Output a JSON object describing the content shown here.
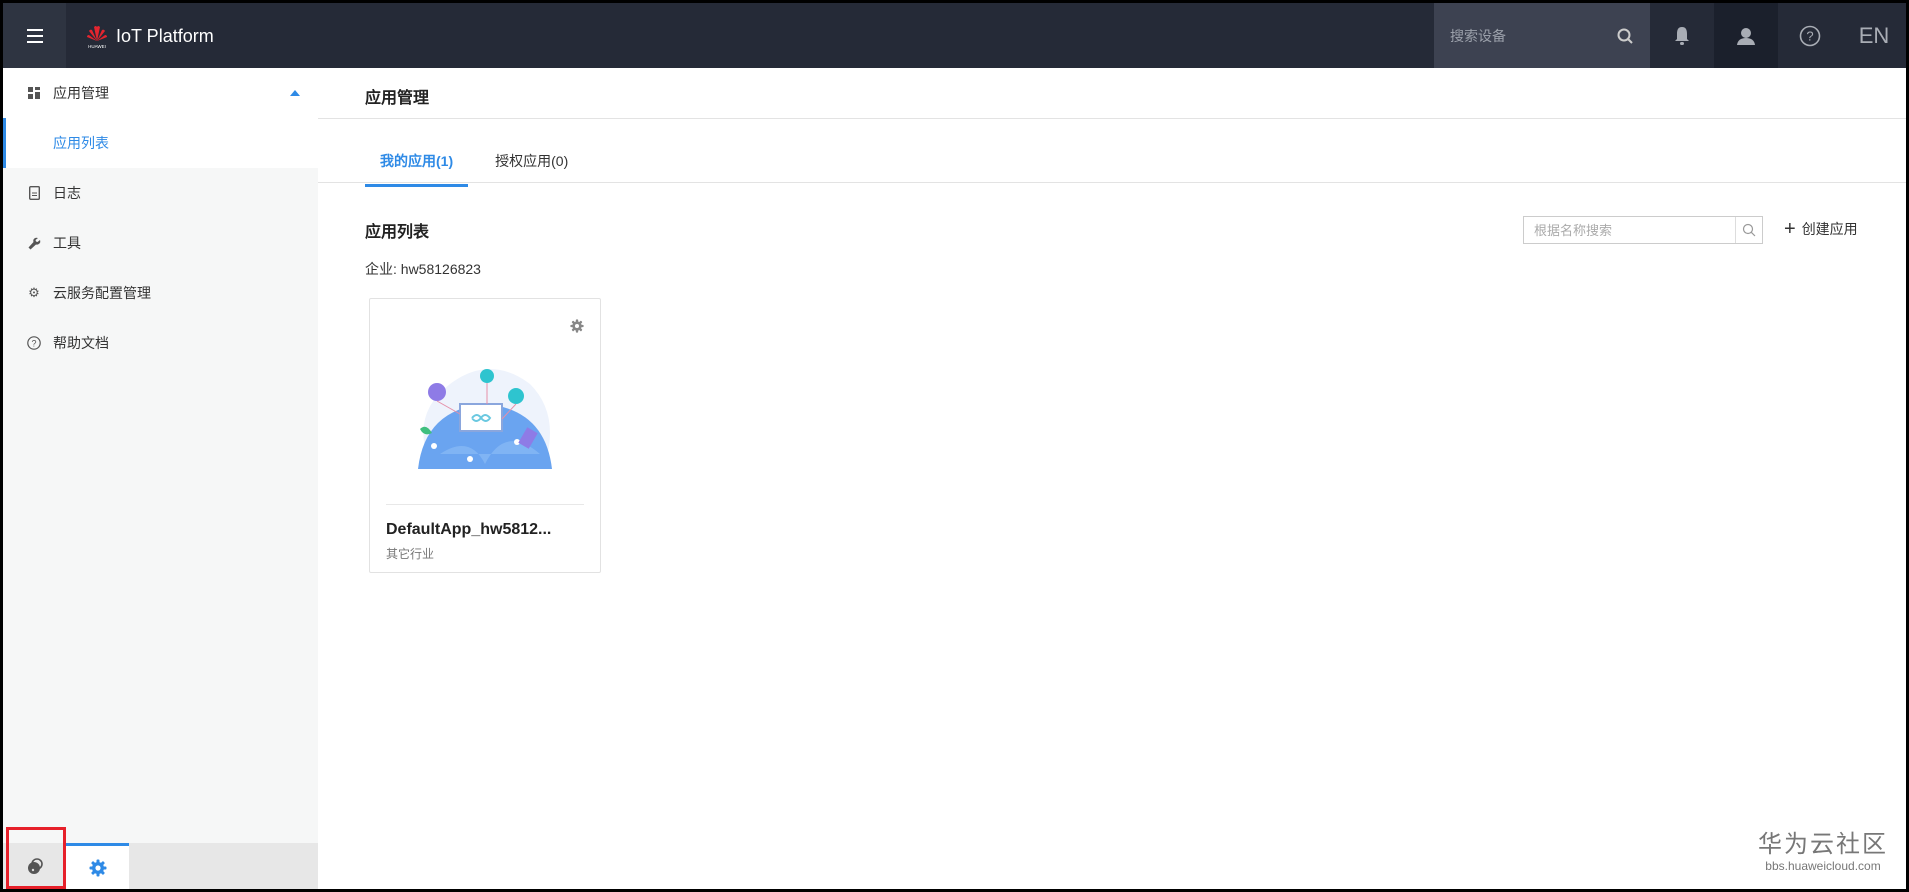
{
  "header": {
    "brand": "HUAWEI",
    "title": "IoT Platform",
    "search_placeholder": "搜索设备",
    "lang": "EN"
  },
  "sidebar": {
    "items": [
      {
        "label": "应用管理",
        "icon": "dashboard-icon",
        "expanded": true
      },
      {
        "label": "应用列表",
        "active": true
      },
      {
        "label": "日志",
        "icon": "document-icon"
      },
      {
        "label": "工具",
        "icon": "wrench-icon"
      },
      {
        "label": "云服务配置管理",
        "icon": "gear-icon"
      },
      {
        "label": "帮助文档",
        "icon": "help-icon"
      }
    ]
  },
  "main": {
    "page_title": "应用管理",
    "tabs": [
      {
        "label": "我的应用(1)",
        "active": true
      },
      {
        "label": "授权应用(0)"
      }
    ],
    "section_title": "应用列表",
    "enterprise": "企业: hw58126823",
    "search_placeholder": "根据名称搜索",
    "create_label": "创建应用",
    "apps": [
      {
        "name": "DefaultApp_hw5812...",
        "industry": "其它行业"
      }
    ]
  },
  "watermark": {
    "title": "华为云社区",
    "url": "bbs.huaweicloud.com"
  },
  "colors": {
    "accent": "#2e8ae6",
    "header_bg": "#252a37",
    "highlight": "#e6202a"
  }
}
